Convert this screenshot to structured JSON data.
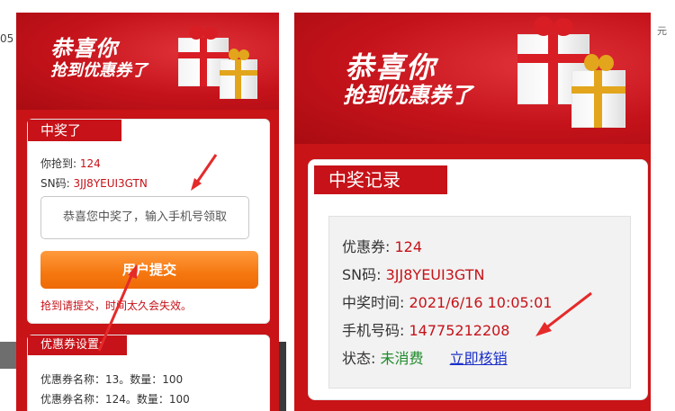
{
  "left_screen": {
    "edge_text": "05",
    "banner": {
      "line1": "恭喜你",
      "line2": "抢到优惠券了"
    },
    "win_card": {
      "tag": "中奖了",
      "grabbed_label": "你抢到:",
      "grabbed_value": "124",
      "sn_label": "SN码:",
      "sn_value": "3JJ8YEUI3GTN",
      "phone_placeholder": "恭喜您中奖了，输入手机号领取",
      "submit_label": "用户提交",
      "warning": "抢到请提交，时间太久会失效。"
    },
    "coupon_card": {
      "tag": "优惠券设置:",
      "lines": [
        "优惠券名称：13。数量：100",
        "优惠券名称：124。数量：100"
      ]
    }
  },
  "right_screen": {
    "banner": {
      "line1": "恭喜你",
      "line2": "抢到优惠券了"
    },
    "record_card": {
      "tag": "中奖记录",
      "coupon_label": "优惠券:",
      "coupon_value": "124",
      "sn_label": "SN码:",
      "sn_value": "3JJ8YEUI3GTN",
      "time_label": "中奖时间:",
      "time_value": "2021/6/16 10:05:01",
      "phone_label": "手机号码:",
      "phone_value": "14775212208",
      "status_label": "状态:",
      "status_value": "未消费",
      "verify_link": "立即核销"
    }
  },
  "far_right_char": "元",
  "colors": {
    "brand_red": "#c81317",
    "button_orange": "#f57710",
    "link_blue": "#1a2fc8",
    "status_green": "#1f8a2a"
  },
  "annotations": [
    "arrow-icon",
    "arrow-icon",
    "arrow-icon"
  ]
}
